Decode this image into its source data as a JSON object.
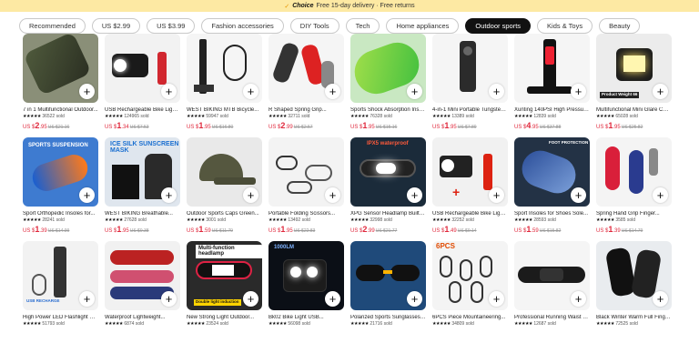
{
  "banner": {
    "check_icon": "check-icon",
    "choice": "Choice",
    "text": "Free 15-day delivery · Free returns"
  },
  "chips": [
    "Recommended",
    "US $2.99",
    "US $3.99",
    "Fashion accessories",
    "DIY Tools",
    "Tech",
    "Home appliances",
    "Outdoor sports",
    "Kids & Toys",
    "Beauty"
  ],
  "active_chip": "Outdoor sports",
  "add_label": "+",
  "products": [
    {
      "title": "7 in 1 Multifunctional Outdoor...",
      "rating": "36522 sold",
      "currency": "US $",
      "price": "2",
      "cents": ".95",
      "old": "US $21.16"
    },
    {
      "title": "USB Rechargeable Bike Light...",
      "rating": "124965 sold",
      "currency": "US $",
      "price": "1",
      "cents": ".34",
      "old": "US $7.53"
    },
    {
      "title": "WEST BIKING MTB Bicycle...",
      "rating": "59947 sold",
      "currency": "US $",
      "price": "1",
      "cents": ".95",
      "old": "US $16.80"
    },
    {
      "title": "R Shaped Spring Grip...",
      "rating": "32711 sold",
      "currency": "US $",
      "price": "2",
      "cents": ".99",
      "old": "US $2.57"
    },
    {
      "title": "Sports Shock Absorption Insol...",
      "rating": "76328 sold",
      "currency": "US $",
      "price": "1",
      "cents": ".95",
      "old": "US $15.16"
    },
    {
      "title": "4-in-1 Mini Portable Tungsten...",
      "rating": "13389 sold",
      "currency": "US $",
      "price": "1",
      "cents": ".95",
      "old": "US $7.89"
    },
    {
      "title": "Xunting 140PSI High Pressure...",
      "rating": "12839 sold",
      "currency": "US $",
      "price": "4",
      "cents": ".95",
      "old": "US $37.88"
    },
    {
      "title": "Multifunctional Mini Glare CO...",
      "rating": "65028 sold",
      "currency": "US $",
      "price": "1",
      "cents": ".95",
      "old": "US $25.82"
    },
    {
      "title": "Sport Orthopedic Insoles for...",
      "rating": "28241 sold",
      "currency": "US $",
      "price": "1",
      "cents": ".39",
      "old": "US $14.99"
    },
    {
      "title": "WEST BIKING Breathable...",
      "rating": "27628 sold",
      "currency": "US $",
      "price": "1",
      "cents": ".95",
      "old": "US $9.38"
    },
    {
      "title": "Outdoor Sports Caps Green...",
      "rating": "3001 sold",
      "currency": "US $",
      "price": "1",
      "cents": ".59",
      "old": "US $11.79"
    },
    {
      "title": "Portable Folding Scissors...",
      "rating": "13492 sold",
      "currency": "US $",
      "price": "1",
      "cents": ".95",
      "old": "US $22.83"
    },
    {
      "title": "XPG Sensor Headlamp Built In...",
      "rating": "32998 sold",
      "currency": "US $",
      "price": "2",
      "cents": ".99",
      "old": "US $21.77"
    },
    {
      "title": "USB Rechargeable Bike Light...",
      "rating": "32252 sold",
      "currency": "US $",
      "price": "1",
      "cents": ".49",
      "old": "US $9.14"
    },
    {
      "title": "Sport Insoles for Shoes Sole...",
      "rating": "28593 sold",
      "currency": "US $",
      "price": "1",
      "cents": ".59",
      "old": "US $15.82"
    },
    {
      "title": "Spring Hand Grip Finger...",
      "rating": "3585 sold",
      "currency": "US $",
      "price": "1",
      "cents": ".39",
      "old": "US $14.79"
    },
    {
      "title": "High Power LED Flashlight US...",
      "rating": "51793 sold",
      "currency": "",
      "price": "",
      "cents": "",
      "old": ""
    },
    {
      "title": "Waterproof Lightweight...",
      "rating": "6874 sold",
      "currency": "",
      "price": "",
      "cents": "",
      "old": ""
    },
    {
      "title": "New Strong Light Outdoor...",
      "rating": "23524 sold",
      "currency": "",
      "price": "",
      "cents": "",
      "old": ""
    },
    {
      "title": "Bk02 Bike Light USB...",
      "rating": "56098 sold",
      "currency": "",
      "price": "",
      "cents": "",
      "old": ""
    },
    {
      "title": "Polarized Sports Sunglasses F...",
      "rating": "21716 sold",
      "currency": "",
      "price": "",
      "cents": "",
      "old": ""
    },
    {
      "title": "6PCS Piece Mountaineering...",
      "rating": "34809 sold",
      "currency": "",
      "price": "",
      "cents": "",
      "old": ""
    },
    {
      "title": "Professional Running Waist B...",
      "rating": "12687 sold",
      "currency": "",
      "price": "",
      "cents": "",
      "old": ""
    },
    {
      "title": "Black Winter Warm Full Finger...",
      "rating": "72525 sold",
      "currency": "",
      "price": "",
      "cents": "",
      "old": ""
    }
  ],
  "thumb_texts": {
    "p8": "Product Weight 66",
    "p9": "SPORTS SUSPENSION",
    "p10": "ICE SILK SUNSCREEN MASK",
    "p13": "IPX5 waterproof",
    "p15": "FOOT PROTECTION",
    "p19": "Multi-function headlamp",
    "p19b": "Double light induction",
    "p20": "1000LM",
    "p22": "6PCS",
    "p17": "USB RECHARGE"
  },
  "stars": "★★★★★"
}
